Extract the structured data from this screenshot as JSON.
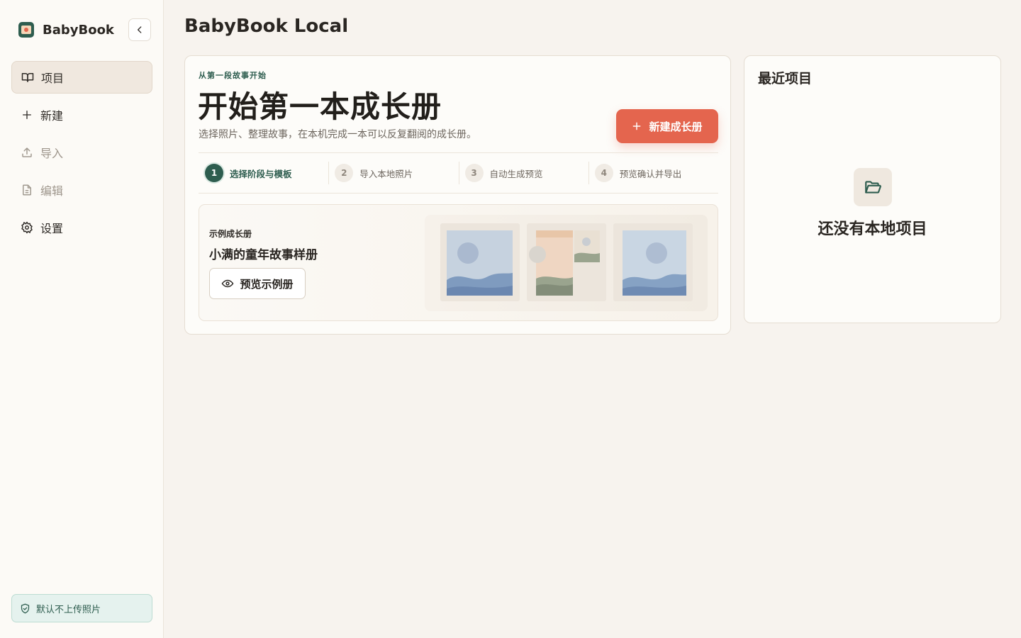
{
  "brand": {
    "name": "BabyBook"
  },
  "sidebar": {
    "items": [
      {
        "label": "项目",
        "icon": "book-icon",
        "state": "active"
      },
      {
        "label": "新建",
        "icon": "plus-icon",
        "state": "normal"
      },
      {
        "label": "导入",
        "icon": "upload-icon",
        "state": "disabled"
      },
      {
        "label": "编辑",
        "icon": "document-icon",
        "state": "disabled"
      },
      {
        "label": "设置",
        "icon": "gear-icon",
        "state": "normal"
      }
    ],
    "privacy_note": "默认不上传照片"
  },
  "main": {
    "title": "BabyBook Local",
    "hero": {
      "eyebrow": "从第一段故事开始",
      "title": "开始第一本成长册",
      "subtitle": "选择照片、整理故事，在本机完成一本可以反复翻阅的成长册。",
      "cta_label": "新建成长册"
    },
    "steps": [
      {
        "num": "1",
        "label": "选择阶段与模板"
      },
      {
        "num": "2",
        "label": "导入本地照片"
      },
      {
        "num": "3",
        "label": "自动生成预览"
      },
      {
        "num": "4",
        "label": "预览确认并导出"
      }
    ],
    "sample": {
      "tag": "示例成长册",
      "name": "小满的童年故事样册",
      "preview_label": "预览示例册"
    }
  },
  "recent": {
    "title": "最近项目",
    "empty_text": "还没有本地项目"
  },
  "colors": {
    "accent": "#e4654e",
    "brand_green": "#2e5d4f",
    "background": "#f7f3ee"
  }
}
